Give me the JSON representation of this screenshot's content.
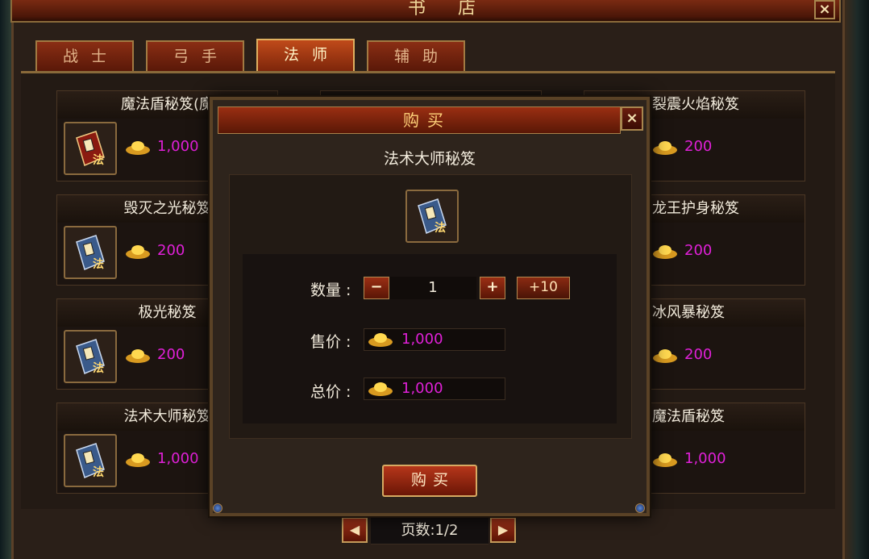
{
  "shop": {
    "title": "书店",
    "close_label": "×",
    "tabs": [
      {
        "label": "战士",
        "active": false
      },
      {
        "label": "弓手",
        "active": false
      },
      {
        "label": "法师",
        "active": true
      },
      {
        "label": "辅助",
        "active": false
      }
    ],
    "items_left": [
      {
        "name": "魔法盾秘笈(魔",
        "price": "1,000",
        "book_color": "red"
      },
      {
        "name": "毁灭之光秘笈",
        "price": "200",
        "book_color": "blue"
      },
      {
        "name": "极光秘笈",
        "price": "200",
        "book_color": "blue"
      },
      {
        "name": "法术大师秘笈",
        "price": "1,000",
        "book_color": "blue"
      }
    ],
    "items_right": [
      {
        "name": "裂震火焰秘笈",
        "price": "200"
      },
      {
        "name": "龙王护身秘笈",
        "price": "200"
      },
      {
        "name": "冰风暴秘笈",
        "price": "200"
      },
      {
        "name": "魔法盾秘笈",
        "price": "1,000"
      }
    ],
    "pager": {
      "prev": "◀",
      "label": "页数:1/2",
      "next": "▶"
    }
  },
  "dialog": {
    "title": "购买",
    "close_label": "×",
    "item_name": "法术大师秘笈",
    "quantity_label": "数量 :",
    "quantity_value": "1",
    "minus_label": "−",
    "plus_label": "+",
    "plus10_label": "+10",
    "unit_price_label": "售价 :",
    "unit_price": "1,000",
    "total_label": "总价 :",
    "total_price": "1,000",
    "buy_label": "购买"
  },
  "colors": {
    "price": "#e020d8",
    "title_gold": "#f0d79a",
    "frame": "#8a6a3e"
  },
  "icons": {
    "currency": "gold-ingot-icon",
    "book_glyph": "法"
  }
}
